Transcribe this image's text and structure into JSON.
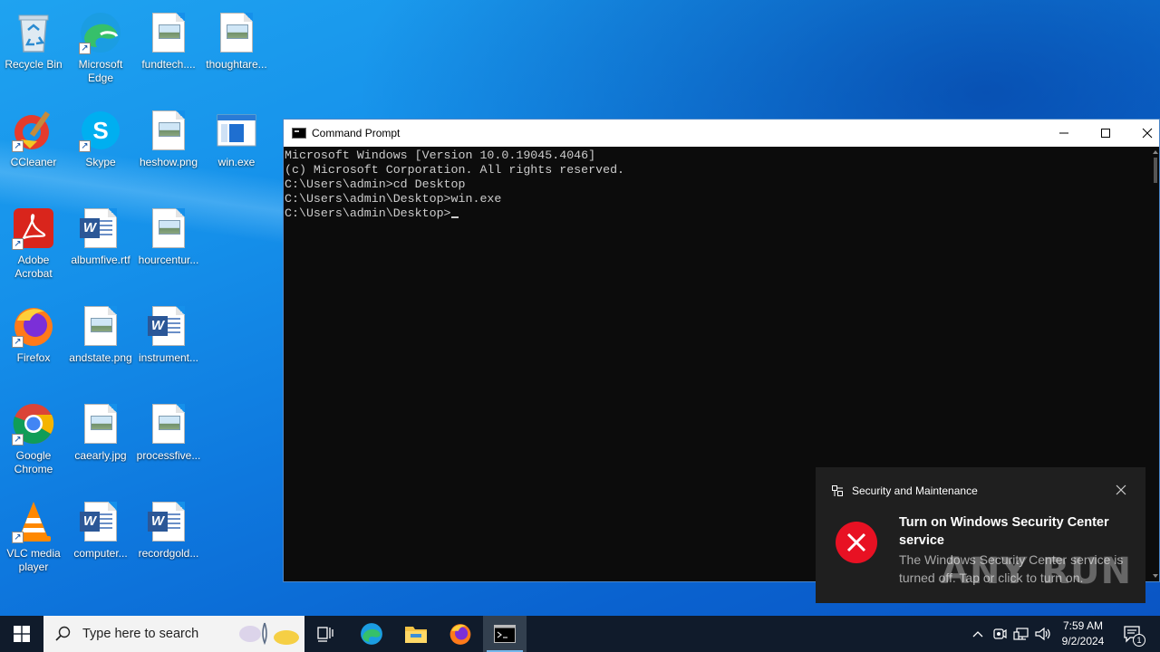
{
  "desktop": {
    "icons": [
      {
        "label": "Recycle Bin",
        "icon": "recycle-bin-icon"
      },
      {
        "label": "Microsoft Edge",
        "icon": "edge-icon"
      },
      {
        "label": "fundtech....",
        "icon": "image-file-icon"
      },
      {
        "label": "thoughtare...",
        "icon": "image-file-icon"
      },
      {
        "label": "CCleaner",
        "icon": "ccleaner-icon"
      },
      {
        "label": "Skype",
        "icon": "skype-icon"
      },
      {
        "label": "heshow.png",
        "icon": "image-file-icon"
      },
      {
        "label": "win.exe",
        "icon": "exe-file-icon"
      },
      {
        "label": "Adobe Acrobat",
        "icon": "acrobat-icon"
      },
      {
        "label": "albumfive.rtf",
        "icon": "word-doc-icon"
      },
      {
        "label": "hourcentur...",
        "icon": "image-file-icon"
      },
      {
        "label": "Firefox",
        "icon": "firefox-icon"
      },
      {
        "label": "andstate.png",
        "icon": "image-file-icon"
      },
      {
        "label": "instrument...",
        "icon": "word-doc-icon"
      },
      {
        "label": "Google Chrome",
        "icon": "chrome-icon"
      },
      {
        "label": "caearly.jpg",
        "icon": "image-file-icon"
      },
      {
        "label": "processfive...",
        "icon": "image-file-icon"
      },
      {
        "label": "VLC media player",
        "icon": "vlc-icon"
      },
      {
        "label": "computer...",
        "icon": "word-doc-icon"
      },
      {
        "label": "recordgold...",
        "icon": "word-doc-icon"
      }
    ]
  },
  "cmd": {
    "title": "Command Prompt",
    "lines": [
      "Microsoft Windows [Version 10.0.19045.4046]",
      "(c) Microsoft Corporation. All rights reserved.",
      "",
      "C:\\Users\\admin>cd Desktop",
      "",
      "C:\\Users\\admin\\Desktop>win.exe",
      "",
      "C:\\Users\\admin\\Desktop>"
    ]
  },
  "toast": {
    "app": "Security and Maintenance",
    "title": "Turn on Windows Security Center service",
    "body": "The Windows Security Center service is turned off. Tap or click to turn on."
  },
  "watermark": {
    "text": "ANY RUN"
  },
  "taskbar": {
    "search_placeholder": "Type here to search",
    "pinned": [
      "task-view-icon",
      "edge-icon",
      "file-explorer-icon",
      "firefox-icon",
      "cmd-icon"
    ],
    "clock_time": "7:59 AM",
    "clock_date": "9/2/2024",
    "notification_count": "1"
  },
  "colors": {
    "toast_bg": "#1f1f1f",
    "error_red": "#e81123",
    "taskbar_bg": "#101b2b",
    "accent": "#76b9ed"
  }
}
